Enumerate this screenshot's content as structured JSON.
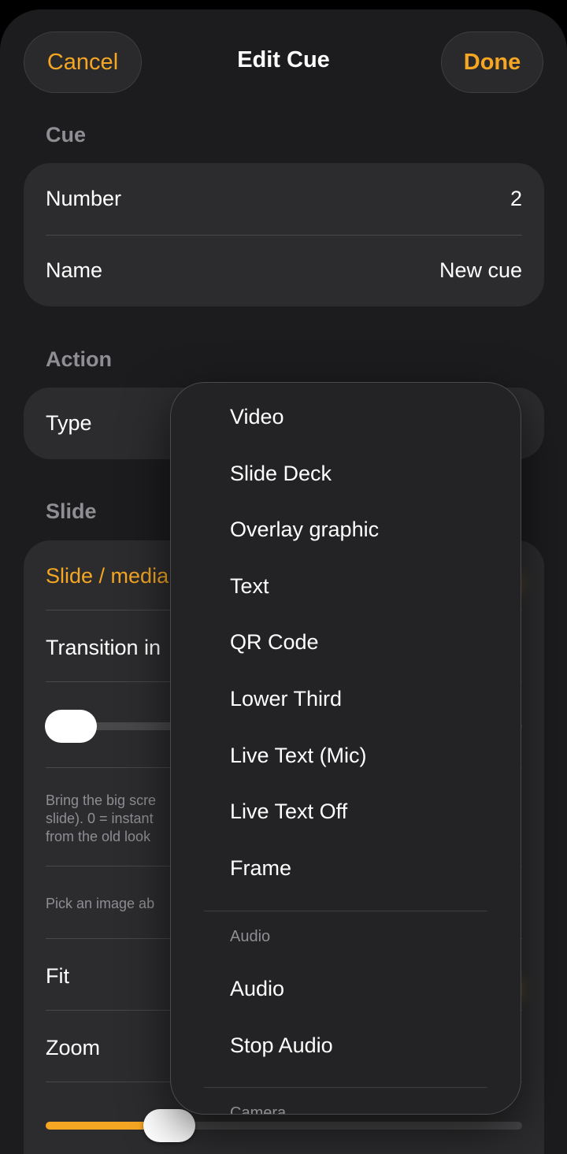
{
  "header": {
    "cancel_label": "Cancel",
    "title": "Edit Cue",
    "done_label": "Done"
  },
  "cue_section": {
    "title": "Cue",
    "rows": [
      {
        "label": "Number",
        "value": "2"
      },
      {
        "label": "Name",
        "value": "New cue"
      }
    ]
  },
  "action_section": {
    "title": "Action",
    "type_label": "Type"
  },
  "slide_section": {
    "title": "Slide",
    "media_label": "Slide / media",
    "transition_label": "Transition in",
    "note_line1": "Bring the big scre",
    "note_line2": "slide). 0 = instant",
    "note_line3": "from the old look",
    "pick_note": "Pick an image ab",
    "fit_label": "Fit",
    "zoom_label": "Zoom",
    "zoom_level": 0.2
  },
  "menu": {
    "items": [
      "Video",
      "Slide Deck",
      "Overlay graphic",
      "Text",
      "QR Code",
      "Lower Third",
      "Live Text (Mic)",
      "Live Text Off",
      "Frame"
    ],
    "audio_header": "Audio",
    "audio_items": [
      "Audio",
      "Stop Audio"
    ],
    "camera_header": "Camera"
  },
  "colors": {
    "accent": "#f5a623",
    "background": "#1c1c1e",
    "group": "#2c2c2e"
  }
}
